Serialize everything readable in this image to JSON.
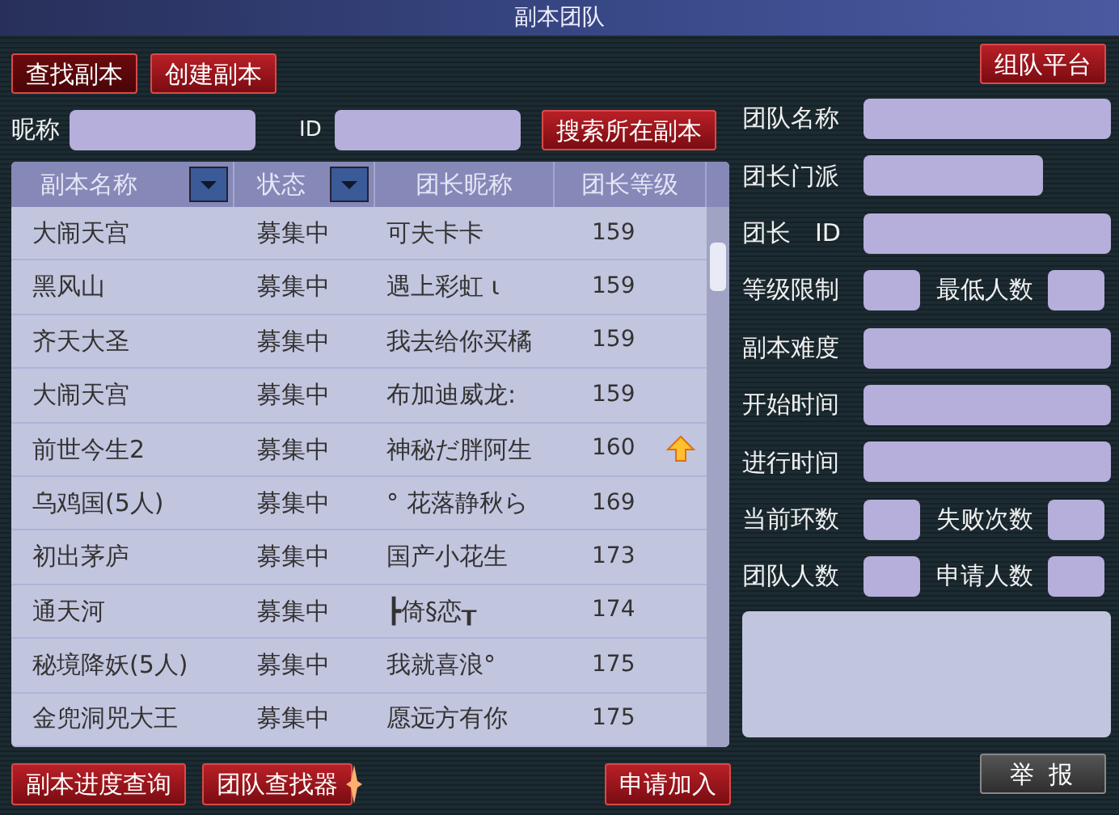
{
  "window": {
    "title": "副本团队"
  },
  "tabs": [
    {
      "label": "查找副本",
      "selected": true
    },
    {
      "label": "创建副本",
      "selected": false
    }
  ],
  "platform_button": "组队平台",
  "search": {
    "nickname_label": "昵称",
    "id_label": "ID",
    "button": "搜索所在副本"
  },
  "table": {
    "columns": [
      {
        "label": "副本名称",
        "dropdown": true
      },
      {
        "label": "状态",
        "dropdown": true
      },
      {
        "label": "团长昵称",
        "dropdown": false
      },
      {
        "label": "团长等级",
        "dropdown": false
      }
    ],
    "rows": [
      {
        "name": "大闹天宫",
        "status": "募集中",
        "leader": "可夫卡卡",
        "level": "159",
        "boosted": false
      },
      {
        "name": "黑风山",
        "status": "募集中",
        "leader": "遇上彩虹 ι",
        "level": "159",
        "boosted": false
      },
      {
        "name": "齐天大圣",
        "status": "募集中",
        "leader": "我去给你买橘",
        "level": "159",
        "boosted": false
      },
      {
        "name": "大闹天宫",
        "status": "募集中",
        "leader": "布加迪威龙:",
        "level": "159",
        "boosted": false
      },
      {
        "name": "前世今生2",
        "status": "募集中",
        "leader": "神秘だ胖阿生",
        "level": "160",
        "boosted": true
      },
      {
        "name": "乌鸡国(5人)",
        "status": "募集中",
        "leader": "° 花落静秋ら",
        "level": "169",
        "boosted": false
      },
      {
        "name": "初出茅庐",
        "status": "募集中",
        "leader": "国产小花生",
        "level": "173",
        "boosted": false
      },
      {
        "name": "通天河",
        "status": "募集中",
        "leader": "┣倚§恋┰",
        "level": "174",
        "boosted": false
      },
      {
        "name": "秘境降妖(5人)",
        "status": "募集中",
        "leader": "我就喜浪°",
        "level": "175",
        "boosted": false
      },
      {
        "name": "金兜洞兕大王",
        "status": "募集中",
        "leader": "愿远方有你",
        "level": "175",
        "boosted": false
      }
    ]
  },
  "details": [
    {
      "kind": "full",
      "labels": [
        "团队名称"
      ]
    },
    {
      "kind": "medium",
      "labels": [
        "团长门派"
      ]
    },
    {
      "kind": "full",
      "labels": [
        "团长　ID"
      ]
    },
    {
      "kind": "pair",
      "labels": [
        "等级限制",
        "最低人数"
      ]
    },
    {
      "kind": "full",
      "labels": [
        "副本难度"
      ]
    },
    {
      "kind": "full",
      "labels": [
        "开始时间"
      ]
    },
    {
      "kind": "full",
      "labels": [
        "进行时间"
      ]
    },
    {
      "kind": "pair",
      "labels": [
        "当前环数",
        "失败次数"
      ]
    },
    {
      "kind": "pair",
      "labels": [
        "团队人数",
        "申请人数"
      ]
    }
  ],
  "bottom_buttons": [
    {
      "label": "副本进度查询",
      "sparkle": false
    },
    {
      "label": "团队查找器",
      "sparkle": true
    },
    {
      "label": "申请加入",
      "sparkle": false
    }
  ],
  "report_button": "举 报"
}
